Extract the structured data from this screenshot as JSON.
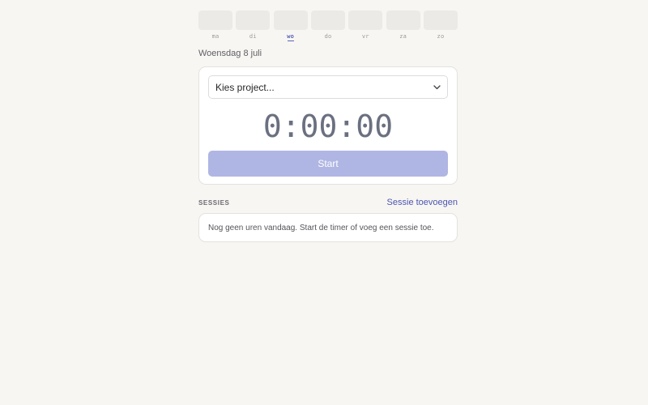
{
  "week": {
    "days": [
      {
        "label": "ma",
        "active": false
      },
      {
        "label": "di",
        "active": false
      },
      {
        "label": "wo",
        "active": true
      },
      {
        "label": "do",
        "active": false
      },
      {
        "label": "vr",
        "active": false
      },
      {
        "label": "za",
        "active": false
      },
      {
        "label": "zo",
        "active": false
      }
    ]
  },
  "date_heading": "Woensdag 8 juli",
  "timer_card": {
    "project_select": {
      "selected": "Kies project...",
      "icon": "chevron-down-icon"
    },
    "time": "0:00:00",
    "start_label": "Start"
  },
  "sessions": {
    "title": "SESSIES",
    "add_label": "Sessie toevoegen",
    "empty_text": "Nog geen uren vandaag. Start de timer of voeg een sessie toe."
  },
  "colors": {
    "background": "#f7f6f2",
    "accent": "#4d55b0",
    "start_button": "#b0b6e3",
    "timer_text": "#6b7080"
  }
}
